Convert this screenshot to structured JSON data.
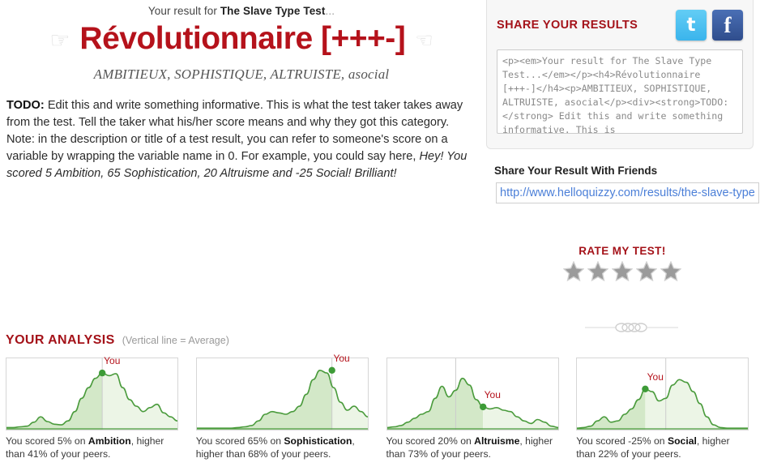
{
  "header": {
    "prefix": "Your result for ",
    "test_name": "The Slave Type Test",
    "ellipsis": "...",
    "left_hand_icon": "☞",
    "right_hand_icon": "☜",
    "title": "Révolutionnaire [+++-]",
    "subtitle": "AMBITIEUX, SOPHISTIQUE, ALTRUISTE, asocial",
    "title_color": "#b5121b"
  },
  "description": {
    "todo_label": "TODO:",
    "body": " Edit this and write something informative. This is what the test taker takes away from the test. Tell the taker what his/her score means and why they got this category. Note: in the description or title of a test result, you can refer to someone's score on a variable by wrapping the variable name in 0. For example, you could say here, ",
    "example": "Hey! You scored 5 Ambition, 65 Sophistication, 20 Altruisme and -25 Social! Brilliant!"
  },
  "share": {
    "title": "SHARE YOUR RESULTS",
    "twitter_icon": "t",
    "facebook_icon": "f",
    "twitter_color": "#55c2f0",
    "facebook_color": "#3b5998",
    "embed_code": "<p><em>Your result for The Slave Type Test...</em></p><h4>Révolutionnaire [+++-]</h4><p>AMBITIEUX, SOPHISTIQUE, ALTRUISTE, asocial</p><div><strong>TODO:</strong> Edit this and write something informative. This is",
    "friends_label": "Share Your Result With Friends",
    "url_value": "http://www.helloquizzy.com/results/the-slave-type-test"
  },
  "rating": {
    "title": "RATE MY TEST!",
    "star_count": 5,
    "stars_filled": 0,
    "star_color": "#9b9b9b"
  },
  "analysis": {
    "title": "YOUR ANALYSIS",
    "note": "(Vertical line = Average)"
  },
  "chart_data": [
    {
      "type": "area",
      "title": "Ambition",
      "caption_prefix": "You scored ",
      "score": "5%",
      "caption_mid": " on ",
      "variable": "Ambition",
      "caption_suffix": ", higher than ",
      "percentile": "41%",
      "caption_end": " of your peers.",
      "you_label": "You",
      "you_x_pct": 56,
      "you_y_pct": 84,
      "average_line_x_pct": 56,
      "xlabel": "",
      "ylabel": "",
      "grid": false,
      "x": [
        0,
        4,
        8,
        12,
        16,
        20,
        24,
        28,
        32,
        36,
        40,
        44,
        48,
        52,
        56,
        60,
        64,
        68,
        72,
        76,
        80,
        84,
        88,
        92,
        96,
        100
      ],
      "y": [
        2,
        2,
        3,
        4,
        10,
        18,
        11,
        7,
        6,
        12,
        26,
        46,
        62,
        76,
        84,
        80,
        83,
        62,
        44,
        34,
        26,
        32,
        37,
        24,
        18,
        12
      ]
    },
    {
      "type": "area",
      "title": "Sophistication",
      "caption_prefix": "You scored ",
      "score": "65%",
      "caption_mid": " on ",
      "variable": "Sophistication",
      "caption_suffix": ", higher than ",
      "percentile": "68%",
      "caption_end": " of your peers.",
      "you_label": "You",
      "you_x_pct": 79,
      "you_y_pct": 88,
      "average_line_x_pct": 79,
      "xlabel": "",
      "ylabel": "",
      "grid": false,
      "x": [
        0,
        4,
        8,
        12,
        16,
        20,
        24,
        28,
        32,
        36,
        40,
        44,
        48,
        52,
        56,
        60,
        64,
        68,
        72,
        76,
        80,
        84,
        88,
        92,
        96,
        100
      ],
      "y": [
        1,
        1,
        1,
        1,
        1,
        1,
        2,
        3,
        5,
        12,
        22,
        26,
        24,
        22,
        26,
        34,
        52,
        74,
        88,
        84,
        62,
        40,
        28,
        34,
        26,
        18
      ]
    },
    {
      "type": "area",
      "title": "Altruisme",
      "caption_prefix": "You scored ",
      "score": "20%",
      "caption_mid": " on ",
      "variable": "Altruisme",
      "caption_suffix": ", higher than ",
      "percentile": "73%",
      "caption_end": " of your peers.",
      "you_label": "You",
      "you_x_pct": 56,
      "you_y_pct": 33,
      "average_line_x_pct": 40,
      "xlabel": "",
      "ylabel": "",
      "grid": false,
      "x": [
        0,
        4,
        8,
        12,
        16,
        20,
        24,
        28,
        32,
        36,
        40,
        44,
        48,
        52,
        56,
        60,
        64,
        68,
        72,
        76,
        80,
        84,
        88,
        92,
        96,
        100
      ],
      "y": [
        2,
        3,
        5,
        10,
        16,
        22,
        26,
        46,
        64,
        48,
        58,
        76,
        66,
        44,
        33,
        30,
        32,
        28,
        26,
        18,
        12,
        8,
        14,
        10,
        4,
        2
      ]
    },
    {
      "type": "area",
      "title": "Social",
      "caption_prefix": "You scored ",
      "score": "-25%",
      "caption_mid": " on ",
      "variable": "Social",
      "caption_suffix": ", higher than ",
      "percentile": "22%",
      "caption_end": " of your peers.",
      "you_label": "You",
      "you_x_pct": 40,
      "you_y_pct": 60,
      "average_line_x_pct": 52,
      "xlabel": "",
      "ylabel": "",
      "grid": false,
      "x": [
        0,
        4,
        8,
        12,
        16,
        20,
        24,
        28,
        32,
        36,
        40,
        44,
        48,
        52,
        56,
        60,
        64,
        68,
        72,
        76,
        80,
        84,
        88,
        92,
        96,
        100
      ],
      "y": [
        1,
        2,
        4,
        12,
        18,
        10,
        12,
        22,
        30,
        44,
        60,
        56,
        42,
        46,
        66,
        74,
        70,
        56,
        38,
        18,
        6,
        2,
        1,
        1,
        1,
        1
      ]
    }
  ],
  "colors": {
    "line": "#4a9b3c",
    "fill_left": "#d3e8c8",
    "fill_right": "#ecf5e6",
    "marker": "#3d9b37",
    "avg_line": "#cccccc"
  }
}
